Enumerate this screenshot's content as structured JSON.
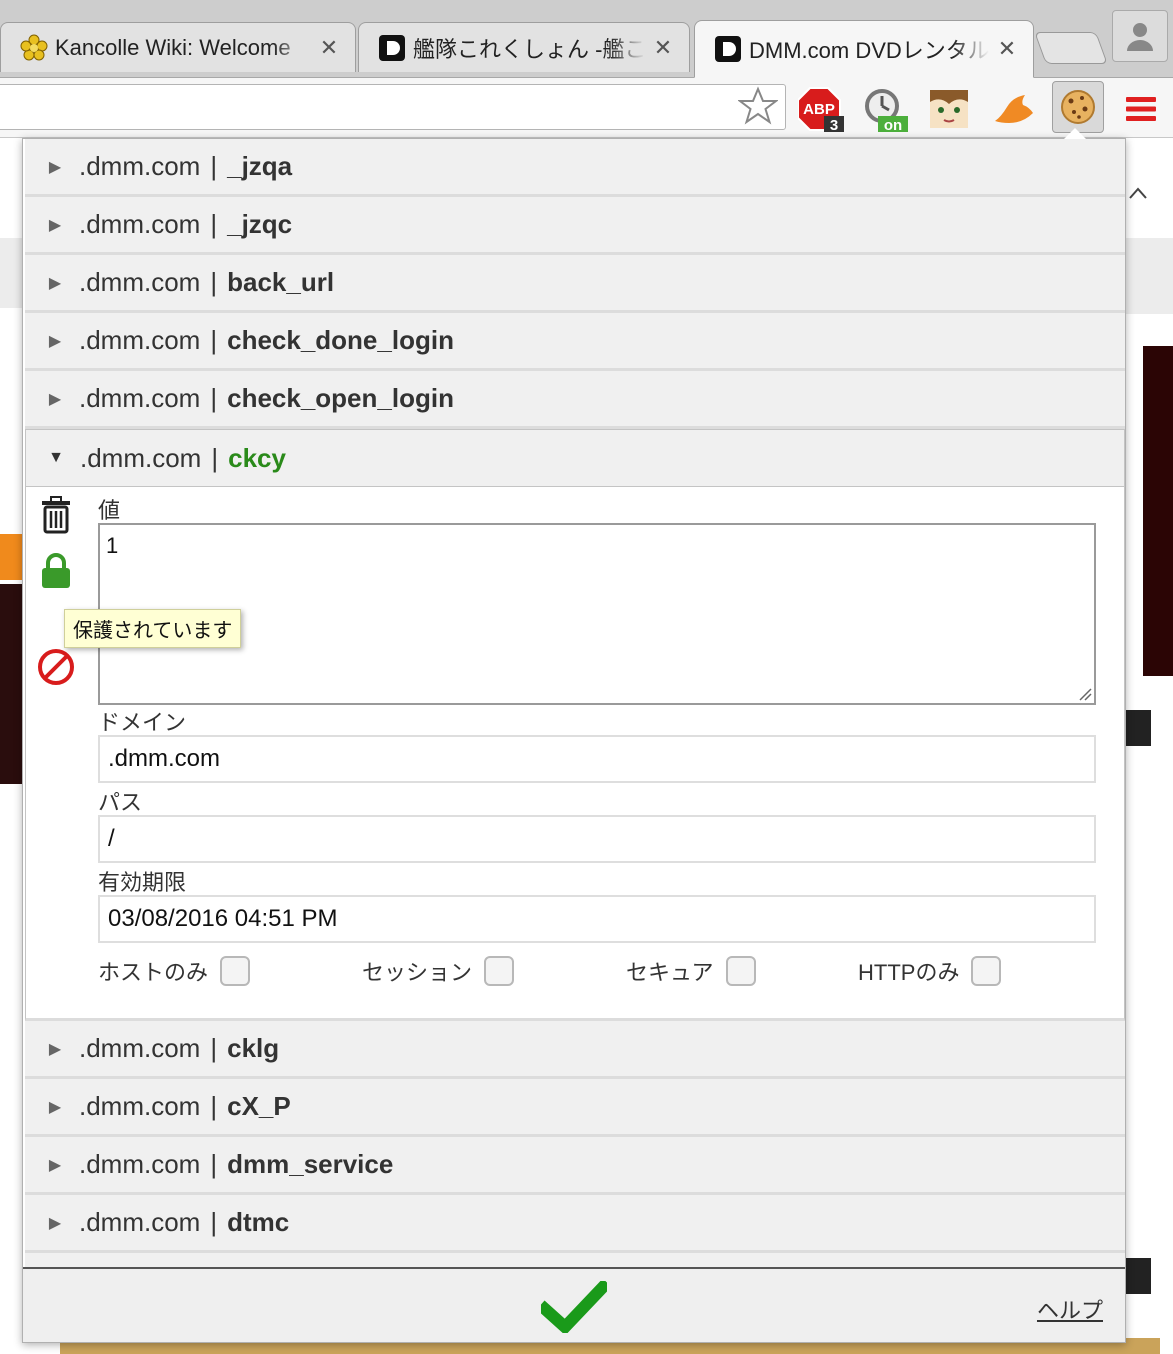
{
  "browser": {
    "tabs": [
      {
        "title": "Kancolle Wiki: Welcome",
        "active": false
      },
      {
        "title": "艦隊これくしょん -艦これ",
        "active": false
      },
      {
        "title": "DMM.com DVDレンタル",
        "active": true
      }
    ],
    "close_glyph": "✕",
    "extensions": [
      {
        "icon": "adblock-plus-icon",
        "label": "ABP",
        "badge": "3"
      },
      {
        "icon": "timer-icon",
        "badge": "on"
      },
      {
        "icon": "anime-face-icon"
      },
      {
        "icon": "orange-bird-icon"
      },
      {
        "icon": "cookie-icon"
      },
      {
        "icon": "hamburger-menu-icon"
      }
    ]
  },
  "cookies": {
    "separator": "|",
    "rows_before": [
      {
        "domain": ".dmm.com",
        "name": "_jzqa"
      },
      {
        "domain": ".dmm.com",
        "name": "_jzqc"
      },
      {
        "domain": ".dmm.com",
        "name": "back_url"
      },
      {
        "domain": ".dmm.com",
        "name": "check_done_login"
      },
      {
        "domain": ".dmm.com",
        "name": "check_open_login"
      }
    ],
    "selected": {
      "domain": ".dmm.com",
      "name": "ckcy",
      "value_label": "値",
      "value": "1",
      "domain_label": "ドメイン",
      "domain_value": ".dmm.com",
      "path_label": "パス",
      "path_value": "/",
      "expiry_label": "有効期限",
      "expiry_value": "03/08/2016 04:51 PM",
      "tooltip": "保護されています",
      "flags": [
        {
          "label": "ホストのみ",
          "checked": false
        },
        {
          "label": "セッション",
          "checked": false
        },
        {
          "label": "セキュア",
          "checked": false
        },
        {
          "label": "HTTPのみ",
          "checked": false
        }
      ]
    },
    "rows_after": [
      {
        "domain": ".dmm.com",
        "name": "cklg"
      },
      {
        "domain": ".dmm.com",
        "name": "cX_P"
      },
      {
        "domain": ".dmm.com",
        "name": "dmm_service"
      },
      {
        "domain": ".dmm.com",
        "name": "dtmc"
      }
    ]
  },
  "footer": {
    "help_label": "ヘルプ"
  },
  "colors": {
    "accent_green": "#2a8a1a",
    "lock_green": "#3a9a2a",
    "block_red": "#d81c1c",
    "row_bg": "#f0f0f0"
  }
}
